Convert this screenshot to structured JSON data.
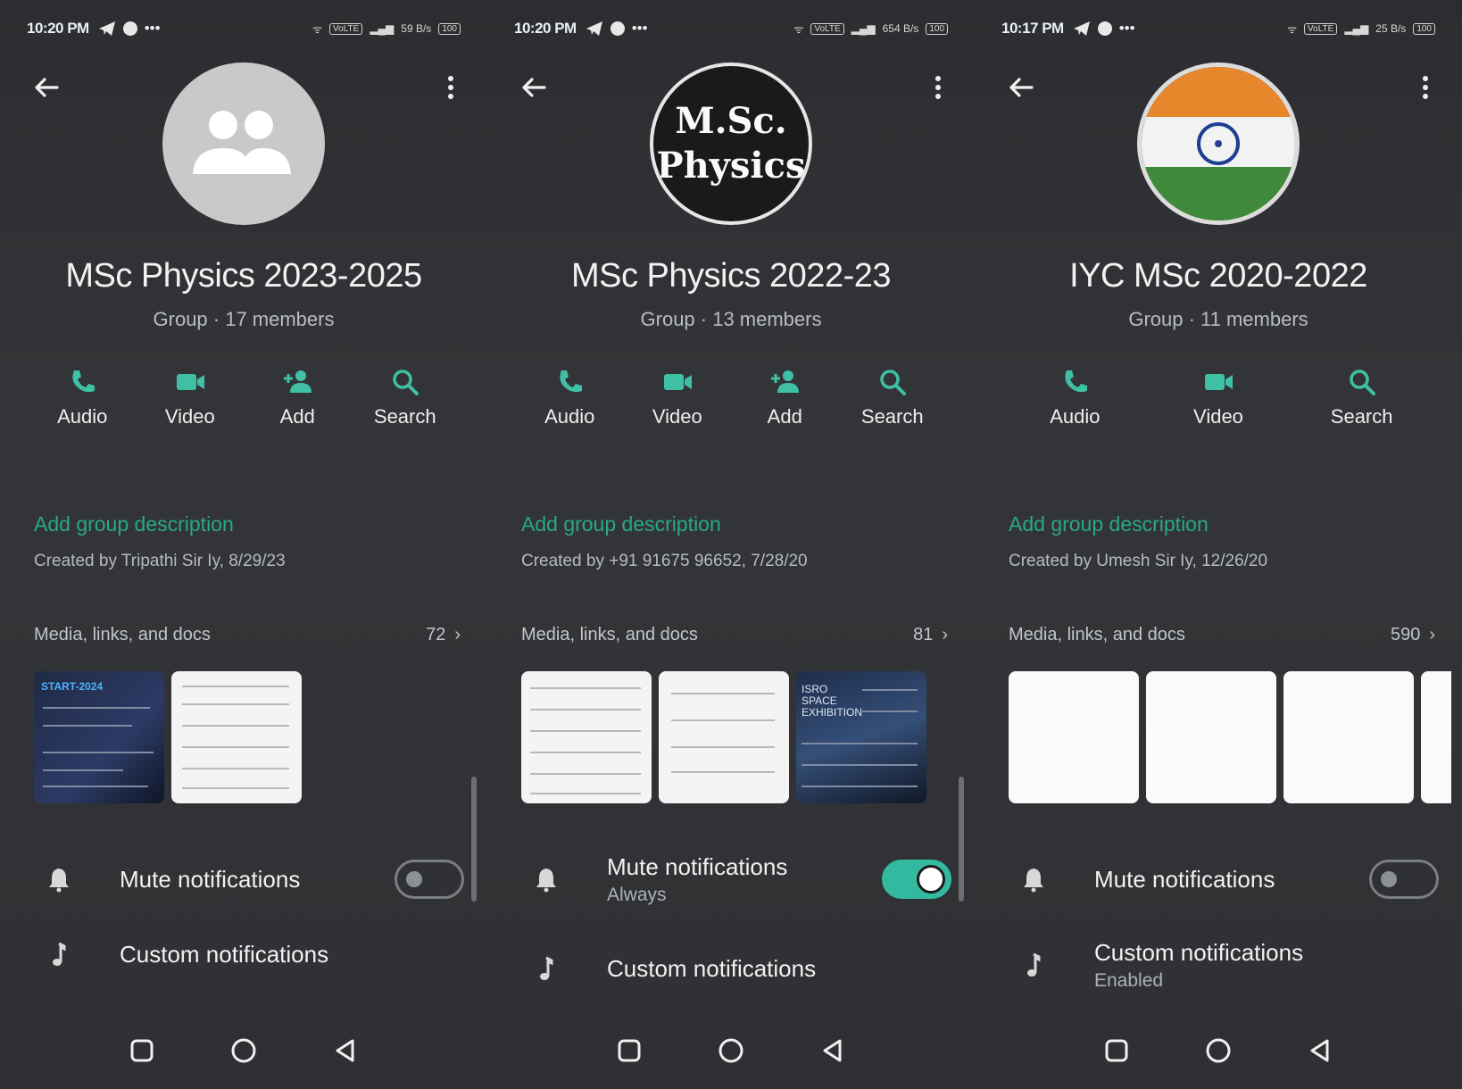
{
  "panels": [
    {
      "status": {
        "time": "10:20 PM",
        "network": "59 B/s",
        "battery": "100"
      },
      "avatar": "group-avatar-default",
      "group_name": "MSc Physics 2023-2025",
      "group_meta": "Group · 17 members",
      "actions": [
        "Audio",
        "Video",
        "Add",
        "Search"
      ],
      "description_prompt": "Add group description",
      "created_by": "Created by Tripathi Sir Iy, 8/29/23",
      "media_label": "Media, links, and docs",
      "media_count": "72",
      "thumb_title": "START-2024",
      "mute_label": "Mute notifications",
      "mute_state": "off",
      "custom_label": "Custom notifications"
    },
    {
      "status": {
        "time": "10:20 PM",
        "network": "654 B/s",
        "battery": "100"
      },
      "avatar_text": [
        "M.Sc.",
        "Physics"
      ],
      "group_name": "MSc Physics 2022-23",
      "group_meta": "Group · 13 members",
      "actions": [
        "Audio",
        "Video",
        "Add",
        "Search"
      ],
      "description_prompt": "Add group description",
      "created_by": "Created by +91 91675 96652, 7/28/20",
      "media_label": "Media, links, and docs",
      "media_count": "81",
      "thumb_caption": "ISRO SPACE EXHIBITION",
      "mute_label": "Mute notifications",
      "mute_sub": "Always",
      "mute_state": "on",
      "custom_label": "Custom notifications"
    },
    {
      "status": {
        "time": "10:17 PM",
        "network": "25 B/s",
        "battery": "100"
      },
      "avatar": "india-flag",
      "group_name": "IYC MSc 2020-2022",
      "group_meta": "Group · 11 members",
      "actions": [
        "Audio",
        "Video",
        "Search"
      ],
      "description_prompt": "Add group description",
      "created_by": "Created by Umesh Sir Iy, 12/26/20",
      "media_label": "Media, links, and docs",
      "media_count": "590",
      "mute_label": "Mute notifications",
      "mute_state": "off",
      "custom_label": "Custom notifications",
      "custom_sub": "Enabled"
    }
  ],
  "colors": {
    "accent": "#33b9a0",
    "accent_text": "#29a88a",
    "background": "#2f3134"
  }
}
